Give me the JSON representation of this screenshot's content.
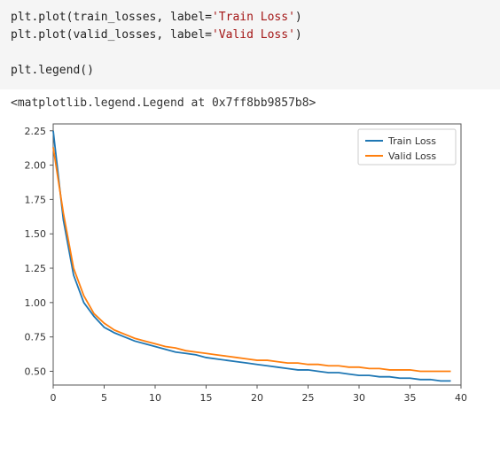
{
  "code": {
    "line1_pre": "plt.plot(train_losses, label=",
    "line1_str": "'Train Loss'",
    "line1_post": ")",
    "line2_pre": "plt.plot(valid_losses, label=",
    "line2_str": "'Valid Loss'",
    "line2_post": ")",
    "line3": "",
    "line4": "plt.legend()"
  },
  "output_repr": "<matplotlib.legend.Legend at 0x7ff8bb9857b8>",
  "chart_data": {
    "type": "line",
    "xlabel": "",
    "ylabel": "",
    "xlim": [
      0,
      40
    ],
    "ylim": [
      0.4,
      2.3
    ],
    "xticks": [
      0,
      5,
      10,
      15,
      20,
      25,
      30,
      35,
      40
    ],
    "yticks": [
      0.5,
      0.75,
      1.0,
      1.25,
      1.5,
      1.75,
      2.0,
      2.25
    ],
    "legend_position": "upper right",
    "colors": {
      "train": "#1f77b4",
      "valid": "#ff7f0e"
    },
    "series": [
      {
        "name": "Train Loss",
        "color": "#1f77b4",
        "x": [
          0,
          1,
          2,
          3,
          4,
          5,
          6,
          7,
          8,
          9,
          10,
          11,
          12,
          13,
          14,
          15,
          16,
          17,
          18,
          19,
          20,
          21,
          22,
          23,
          24,
          25,
          26,
          27,
          28,
          29,
          30,
          31,
          32,
          33,
          34,
          35,
          36,
          37,
          38,
          39
        ],
        "y": [
          2.25,
          1.6,
          1.2,
          1.0,
          0.9,
          0.82,
          0.78,
          0.75,
          0.72,
          0.7,
          0.68,
          0.66,
          0.64,
          0.63,
          0.62,
          0.6,
          0.59,
          0.58,
          0.57,
          0.56,
          0.55,
          0.54,
          0.53,
          0.52,
          0.51,
          0.51,
          0.5,
          0.49,
          0.49,
          0.48,
          0.47,
          0.47,
          0.46,
          0.46,
          0.45,
          0.45,
          0.44,
          0.44,
          0.43,
          0.43
        ]
      },
      {
        "name": "Valid Loss",
        "color": "#ff7f0e",
        "x": [
          0,
          1,
          2,
          3,
          4,
          5,
          6,
          7,
          8,
          9,
          10,
          11,
          12,
          13,
          14,
          15,
          16,
          17,
          18,
          19,
          20,
          21,
          22,
          23,
          24,
          25,
          26,
          27,
          28,
          29,
          30,
          31,
          32,
          33,
          34,
          35,
          36,
          37,
          38,
          39
        ],
        "y": [
          2.13,
          1.65,
          1.25,
          1.05,
          0.92,
          0.85,
          0.8,
          0.77,
          0.74,
          0.72,
          0.7,
          0.68,
          0.67,
          0.65,
          0.64,
          0.63,
          0.62,
          0.61,
          0.6,
          0.59,
          0.58,
          0.58,
          0.57,
          0.56,
          0.56,
          0.55,
          0.55,
          0.54,
          0.54,
          0.53,
          0.53,
          0.52,
          0.52,
          0.51,
          0.51,
          0.51,
          0.5,
          0.5,
          0.5,
          0.5
        ]
      }
    ]
  },
  "legend": {
    "items": [
      "Train Loss",
      "Valid Loss"
    ]
  }
}
